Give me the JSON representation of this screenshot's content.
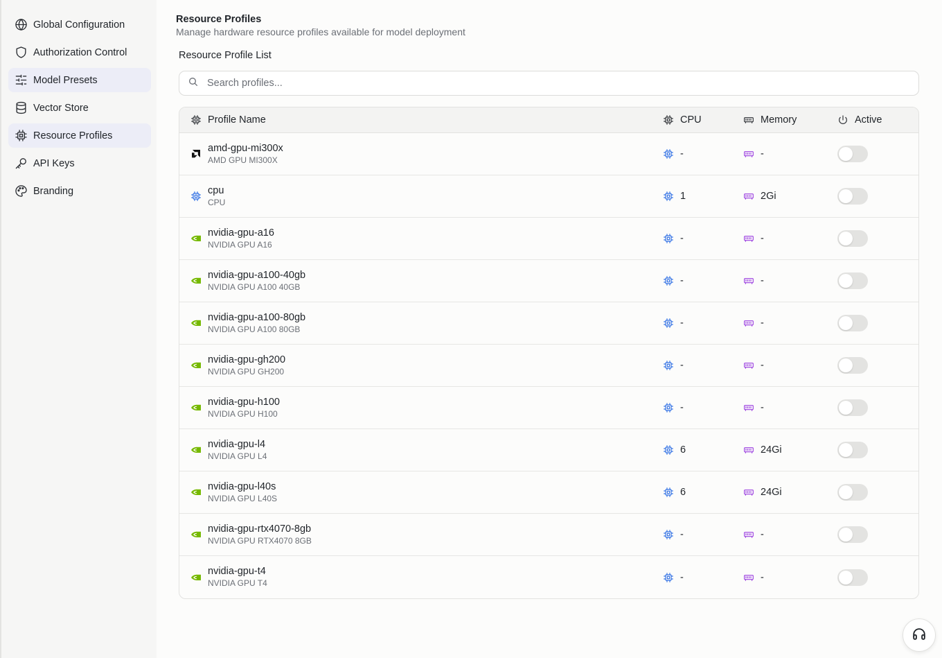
{
  "sidebar": {
    "items": [
      {
        "label": "Global Configuration",
        "icon": "globe-icon",
        "active": false
      },
      {
        "label": "Authorization Control",
        "icon": "shield-icon",
        "active": false
      },
      {
        "label": "Model Presets",
        "icon": "sliders-icon",
        "active": true
      },
      {
        "label": "Vector Store",
        "icon": "database-icon",
        "active": false
      },
      {
        "label": "Resource Profiles",
        "icon": "chip-icon",
        "active": true
      },
      {
        "label": "API Keys",
        "icon": "key-icon",
        "active": false
      },
      {
        "label": "Branding",
        "icon": "palette-icon",
        "active": false
      }
    ]
  },
  "header": {
    "title": "Resource Profiles",
    "subtitle": "Manage hardware resource profiles available for model deployment"
  },
  "list": {
    "title": "Resource Profile List",
    "search_placeholder": "Search profiles...",
    "columns": {
      "name": "Profile Name",
      "cpu": "CPU",
      "memory": "Memory",
      "active": "Active"
    },
    "rows": [
      {
        "name": "amd-gpu-mi300x",
        "description": "AMD GPU MI300X",
        "vendor": "amd",
        "cpu": "-",
        "memory": "-",
        "active": false
      },
      {
        "name": "cpu",
        "description": "CPU",
        "vendor": "cpu",
        "cpu": "1",
        "memory": "2Gi",
        "active": false
      },
      {
        "name": "nvidia-gpu-a16",
        "description": "NVIDIA GPU A16",
        "vendor": "nvidia",
        "cpu": "-",
        "memory": "-",
        "active": false
      },
      {
        "name": "nvidia-gpu-a100-40gb",
        "description": "NVIDIA GPU A100 40GB",
        "vendor": "nvidia",
        "cpu": "-",
        "memory": "-",
        "active": false
      },
      {
        "name": "nvidia-gpu-a100-80gb",
        "description": "NVIDIA GPU A100 80GB",
        "vendor": "nvidia",
        "cpu": "-",
        "memory": "-",
        "active": false
      },
      {
        "name": "nvidia-gpu-gh200",
        "description": "NVIDIA GPU GH200",
        "vendor": "nvidia",
        "cpu": "-",
        "memory": "-",
        "active": false
      },
      {
        "name": "nvidia-gpu-h100",
        "description": "NVIDIA GPU H100",
        "vendor": "nvidia",
        "cpu": "-",
        "memory": "-",
        "active": false
      },
      {
        "name": "nvidia-gpu-l4",
        "description": "NVIDIA GPU L4",
        "vendor": "nvidia",
        "cpu": "6",
        "memory": "24Gi",
        "active": false
      },
      {
        "name": "nvidia-gpu-l40s",
        "description": "NVIDIA GPU L40S",
        "vendor": "nvidia",
        "cpu": "6",
        "memory": "24Gi",
        "active": false
      },
      {
        "name": "nvidia-gpu-rtx4070-8gb",
        "description": "NVIDIA GPU RTX4070 8GB",
        "vendor": "nvidia",
        "cpu": "-",
        "memory": "-",
        "active": false
      },
      {
        "name": "nvidia-gpu-t4",
        "description": "NVIDIA GPU T4",
        "vendor": "nvidia",
        "cpu": "-",
        "memory": "-",
        "active": false
      }
    ]
  },
  "colors": {
    "accent_nav": "#ecedf7",
    "cpu_icon": "#2f6fe4",
    "memory_icon": "#9b3fe0",
    "nvidia_green": "#76b900",
    "toggle_off": "#e3e3e1"
  },
  "help_button_icon": "headphones-icon"
}
